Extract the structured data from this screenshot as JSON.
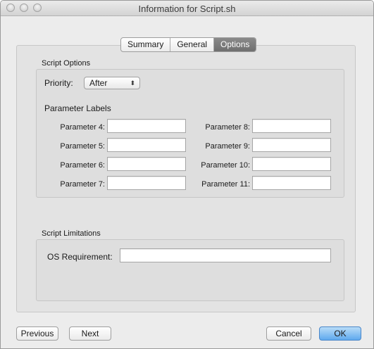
{
  "window": {
    "title": "Information for Script.sh"
  },
  "tabs": [
    {
      "label": "Summary",
      "active": false
    },
    {
      "label": "General",
      "active": false
    },
    {
      "label": "Options",
      "active": true
    }
  ],
  "script_options": {
    "section_label": "Script Options",
    "priority_label": "Priority:",
    "priority_value": "After",
    "parameter_labels_heading": "Parameter Labels",
    "left_params": [
      {
        "label": "Parameter 4:",
        "value": ""
      },
      {
        "label": "Parameter 5:",
        "value": ""
      },
      {
        "label": "Parameter 6:",
        "value": ""
      },
      {
        "label": "Parameter 7:",
        "value": ""
      }
    ],
    "right_params": [
      {
        "label": "Parameter 8:",
        "value": ""
      },
      {
        "label": "Parameter 9:",
        "value": ""
      },
      {
        "label": "Parameter 10:",
        "value": ""
      },
      {
        "label": "Parameter 11:",
        "value": ""
      }
    ]
  },
  "script_limitations": {
    "section_label": "Script Limitations",
    "os_requirement_label": "OS Requirement:",
    "os_requirement_value": ""
  },
  "footer": {
    "previous_label": "Previous",
    "next_label": "Next",
    "cancel_label": "Cancel",
    "ok_label": "OK"
  },
  "colors": {
    "accent": "#5fa9ee",
    "active_tab": "#7a7a7a"
  }
}
